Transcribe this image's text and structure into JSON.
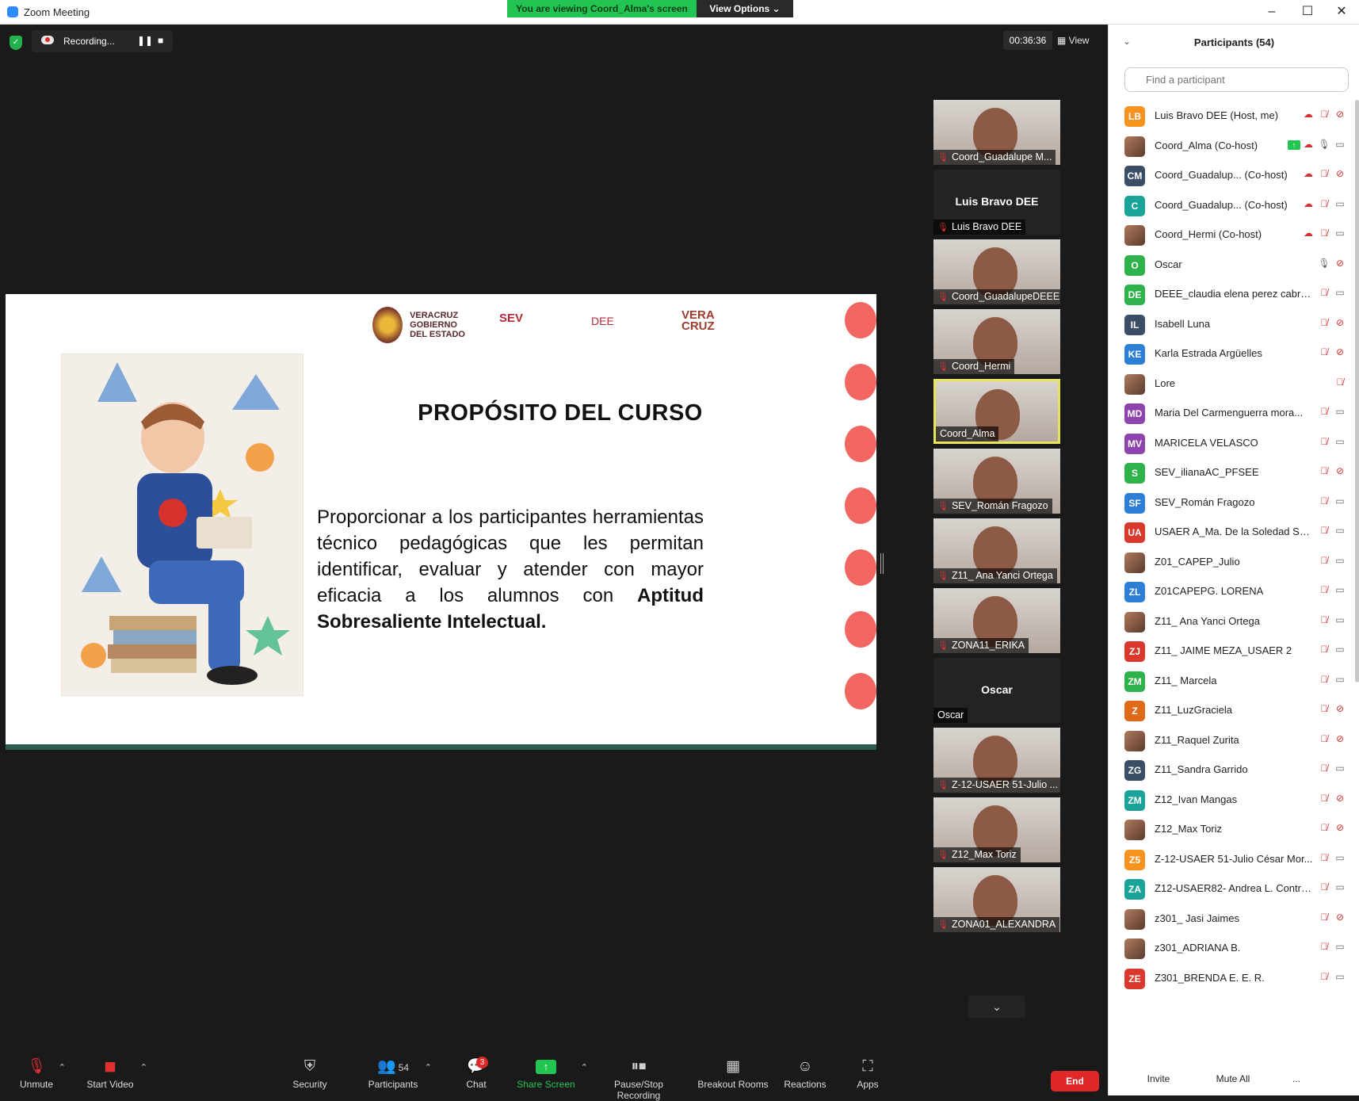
{
  "window": {
    "title": "Zoom Meeting",
    "minimize": "–",
    "maximize": "☐",
    "close": "✕"
  },
  "banner": {
    "viewing": "You are viewing Coord_Alma's screen",
    "view_options": "View Options ⌄"
  },
  "meeting": {
    "recording_label": "Recording...",
    "timer": "00:36:36",
    "view_label": "View"
  },
  "slide": {
    "logo_veracruz": "VERACRUZ GOBIERNO DEL ESTADO",
    "logo_sev": "SEV",
    "logo_dee": "DEE",
    "logo_veracruz_brand": "VERA CRUZ",
    "title": "PROPÓSITO DEL CURSO",
    "body_plain": "Proporcionar a los participantes herramientas técnico pedagógicas que les permitan identificar, evaluar y atender con mayor eficacia a los alumnos con",
    "body_bold": "Aptitud Sobresaliente Intelectual."
  },
  "video_tiles": [
    {
      "name": "Coord_Guadalupe M...",
      "muted": true,
      "photo": true
    },
    {
      "name": "Luis Bravo DEE",
      "center": "Luis Bravo DEE",
      "muted": true,
      "photo": false
    },
    {
      "name": "Coord_GuadalupeDEEE",
      "muted": true,
      "photo": true
    },
    {
      "name": "Coord_Hermi",
      "muted": true,
      "photo": true
    },
    {
      "name": "Coord_Alma",
      "muted": false,
      "photo": true,
      "active": true
    },
    {
      "name": "SEV_Román Fragozo",
      "muted": true,
      "photo": true
    },
    {
      "name": "Z11_ Ana Yanci Ortega",
      "muted": true,
      "photo": true
    },
    {
      "name": "ZONA11_ERIKA",
      "muted": true,
      "photo": true
    },
    {
      "name": "Oscar",
      "center": "Oscar",
      "muted": false,
      "photo": false
    },
    {
      "name": "Z-12-USAER 51-Julio ...",
      "muted": true,
      "photo": true
    },
    {
      "name": "Z12_Max Toriz",
      "muted": true,
      "photo": true
    },
    {
      "name": "ZONA01_ALEXANDRA",
      "muted": true,
      "photo": true
    }
  ],
  "toolbar": {
    "unmute": "Unmute",
    "start_video": "Start Video",
    "security": "Security",
    "participants": "Participants",
    "participants_count": "54",
    "chat": "Chat",
    "chat_badge": "3",
    "share_screen": "Share Screen",
    "pause_stop_recording": "Pause/Stop Recording",
    "breakout_rooms": "Breakout Rooms",
    "reactions": "Reactions",
    "apps": "Apps",
    "end": "End"
  },
  "participants_panel": {
    "title": "Participants (54)",
    "search_placeholder": "Find a participant",
    "invite": "Invite",
    "mute_all": "Mute All",
    "more": "...",
    "colors": {
      "orange": "#f7931e",
      "teal": "#1aa398",
      "green": "#2eb24c",
      "blue": "#2d7ed6",
      "slate": "#3a4f66",
      "red": "#d9382c",
      "purple": "#8e44ad",
      "darkorange": "#e06a1a"
    },
    "items": [
      {
        "initials": "LB",
        "color": "#f7931e",
        "name": "Luis Bravo DEE (Host, me)",
        "icons": "rec,micoff,camoff"
      },
      {
        "initials": "",
        "color": "",
        "name": "Coord_Alma (Co-host)",
        "icons": "share,rec,micon,cam"
      },
      {
        "initials": "CM",
        "color": "#3a4f66",
        "name": "Coord_Guadalup...  (Co-host)",
        "icons": "rec,micoff,camoff"
      },
      {
        "initials": "C",
        "color": "#1aa398",
        "name": "Coord_Guadalup...  (Co-host)",
        "icons": "rec,micoff,cam"
      },
      {
        "initials": "",
        "color": "",
        "name": "Coord_Hermi (Co-host)",
        "icons": "rec,micoff,cam"
      },
      {
        "initials": "O",
        "color": "#2eb24c",
        "name": "Oscar",
        "icons": "micon,camoff"
      },
      {
        "initials": "DE",
        "color": "#2eb24c",
        "name": "DEEE_claudia elena perez cabre...",
        "icons": "micoff,cam"
      },
      {
        "initials": "IL",
        "color": "#3a4f66",
        "name": "Isabell Luna",
        "icons": "micoff,camoff"
      },
      {
        "initials": "KE",
        "color": "#2d7ed6",
        "name": "Karla Estrada Argüelles",
        "icons": "micoff,camoff"
      },
      {
        "initials": "",
        "color": "",
        "name": "Lore",
        "icons": "micoff"
      },
      {
        "initials": "MD",
        "color": "#8e44ad",
        "name": "Maria Del Carmenguerra mora...",
        "icons": "micoff,cam"
      },
      {
        "initials": "MV",
        "color": "#8e44ad",
        "name": "MARICELA VELASCO",
        "icons": "micoff,cam"
      },
      {
        "initials": "S",
        "color": "#2eb24c",
        "name": "SEV_ilianaAC_PFSEE",
        "icons": "micoff,camoff"
      },
      {
        "initials": "SF",
        "color": "#2d7ed6",
        "name": "SEV_Román Fragozo",
        "icons": "micoff,cam"
      },
      {
        "initials": "UA",
        "color": "#d9382c",
        "name": "USAER A_Ma. De la Soledad Sá...",
        "icons": "micoff,cam"
      },
      {
        "initials": "",
        "color": "",
        "name": "Z01_CAPEP_Julio",
        "icons": "micoff,cam"
      },
      {
        "initials": "ZL",
        "color": "#2d7ed6",
        "name": "Z01CAPEPG. LORENA",
        "icons": "micoff,cam"
      },
      {
        "initials": "",
        "color": "",
        "name": "Z11_ Ana Yanci Ortega",
        "icons": "micoff,cam"
      },
      {
        "initials": "ZJ",
        "color": "#d9382c",
        "name": "Z11_ JAIME MEZA_USAER 2",
        "icons": "micoff,cam"
      },
      {
        "initials": "ZM",
        "color": "#2eb24c",
        "name": "Z11_ Marcela",
        "icons": "micoff,cam"
      },
      {
        "initials": "Z",
        "color": "#e06a1a",
        "name": "Z11_LuzGraciela",
        "icons": "micoff,camoff"
      },
      {
        "initials": "",
        "color": "",
        "name": "Z11_Raquel Zurita",
        "icons": "micoff,camoff"
      },
      {
        "initials": "ZG",
        "color": "#3a4f66",
        "name": "Z11_Sandra Garrido",
        "icons": "micoff,cam"
      },
      {
        "initials": "ZM",
        "color": "#1aa398",
        "name": "Z12_Ivan Mangas",
        "icons": "micoff,camoff"
      },
      {
        "initials": "",
        "color": "",
        "name": "Z12_Max Toriz",
        "icons": "micoff,camoff"
      },
      {
        "initials": "Z5",
        "color": "#f7931e",
        "name": "Z-12-USAER 51-Julio César Mor...",
        "icons": "micoff,cam"
      },
      {
        "initials": "ZA",
        "color": "#1aa398",
        "name": "Z12-USAER82- Andrea L. Contre...",
        "icons": "micoff,cam"
      },
      {
        "initials": "",
        "color": "",
        "name": "z301_ Jasi Jaimes",
        "icons": "micoff,camoff"
      },
      {
        "initials": "",
        "color": "",
        "name": "z301_ADRIANA B.",
        "icons": "micoff,cam"
      },
      {
        "initials": "ZE",
        "color": "#d9382c",
        "name": "Z301_BRENDA E. E. R.",
        "icons": "micoff,cam"
      }
    ]
  }
}
